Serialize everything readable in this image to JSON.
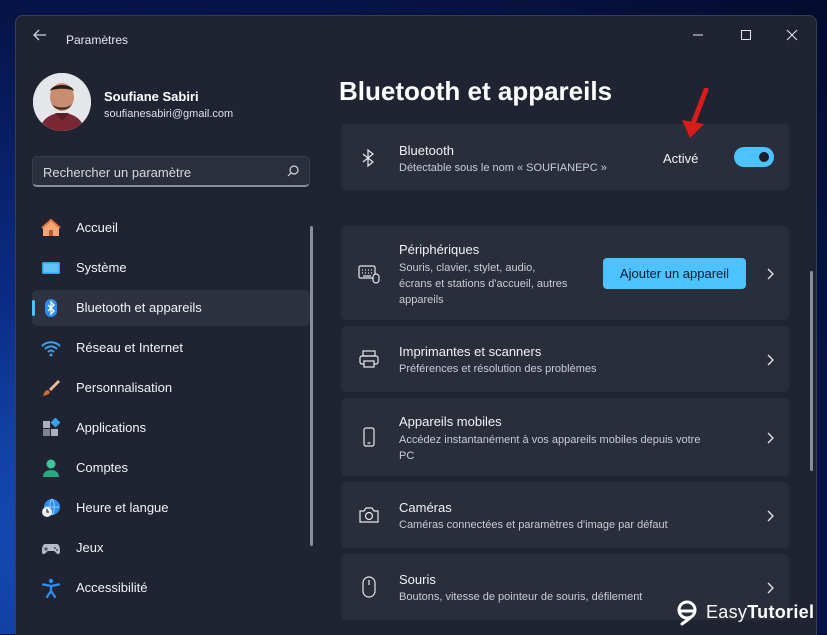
{
  "window": {
    "title": "Paramètres"
  },
  "profile": {
    "name": "Soufiane Sabiri",
    "email": "soufianesabiri@gmail.com"
  },
  "search": {
    "placeholder": "Rechercher un paramètre"
  },
  "sidebar": {
    "items": [
      {
        "label": "Accueil",
        "icon": "home-icon"
      },
      {
        "label": "Système",
        "icon": "system-icon"
      },
      {
        "label": "Bluetooth et appareils",
        "icon": "bluetooth-icon",
        "active": true
      },
      {
        "label": "Réseau et Internet",
        "icon": "wifi-icon"
      },
      {
        "label": "Personnalisation",
        "icon": "brush-icon"
      },
      {
        "label": "Applications",
        "icon": "apps-icon"
      },
      {
        "label": "Comptes",
        "icon": "account-icon"
      },
      {
        "label": "Heure et langue",
        "icon": "clock-globe-icon"
      },
      {
        "label": "Jeux",
        "icon": "gamepad-icon"
      },
      {
        "label": "Accessibilité",
        "icon": "accessibility-icon"
      }
    ]
  },
  "main": {
    "title": "Bluetooth et appareils",
    "bluetooth": {
      "title": "Bluetooth",
      "description": "Détectable sous le nom « SOUFIANEPC »",
      "state_label": "Activé",
      "enabled": true
    },
    "cards": [
      {
        "title": "Périphériques",
        "description_lines": [
          "Souris, clavier, stylet, audio,",
          "écrans et stations d'accueil, autres",
          "appareils"
        ],
        "button": "Ajouter un appareil",
        "icon": "keyboard-icon"
      },
      {
        "title": "Imprimantes et scanners",
        "description_lines": [
          "Préférences et résolution des problèmes"
        ],
        "icon": "printer-icon"
      },
      {
        "title": "Appareils mobiles",
        "description_lines": [
          "Accédez instantanément à vos appareils mobiles depuis votre",
          "PC"
        ],
        "icon": "phone-icon"
      },
      {
        "title": "Caméras",
        "description_lines": [
          "Caméras connectées et paramètres d'image par défaut"
        ],
        "icon": "camera-icon"
      },
      {
        "title": "Souris",
        "description_lines": [
          "Boutons, vitesse de pointeur de souris, défilement"
        ],
        "icon": "mouse-icon"
      }
    ]
  },
  "watermark": {
    "prefix": "Easy",
    "suffix": "Tutoriel"
  },
  "colors": {
    "accent": "#4cc2ff",
    "window_bg": "#202432",
    "card_bg": "#2a2e3b",
    "arrow": "#d81b1b"
  }
}
